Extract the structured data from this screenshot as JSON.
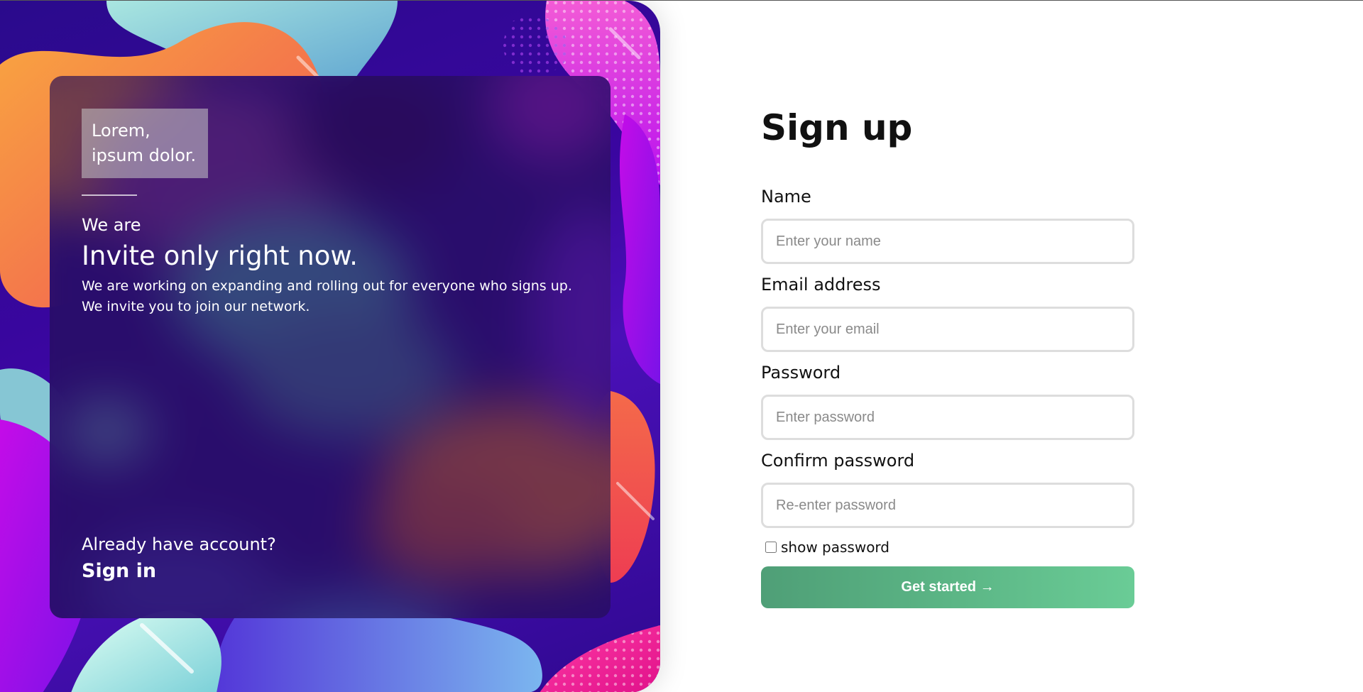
{
  "promo": {
    "logo_line1": "Lorem,",
    "logo_line2": "ipsum dolor.",
    "we_are": "We are",
    "headline": "Invite only right now.",
    "desc_line1": "We are working on expanding and rolling out for everyone who signs up.",
    "desc_line2": "We invite you to join our network.",
    "already": "Already have account?",
    "signin": "Sign in"
  },
  "form": {
    "title": "Sign up",
    "name_label": "Name",
    "name_placeholder": "Enter your name",
    "email_label": "Email address",
    "email_placeholder": "Enter your email",
    "password_label": "Password",
    "password_placeholder": "Enter password",
    "confirm_label": "Confirm password",
    "confirm_placeholder": "Re-enter password",
    "show_password": "show password",
    "submit": "Get started →"
  },
  "colors": {
    "button_start": "#4f9f77",
    "button_end": "#6acc96",
    "art_base": "#3a06a0"
  }
}
